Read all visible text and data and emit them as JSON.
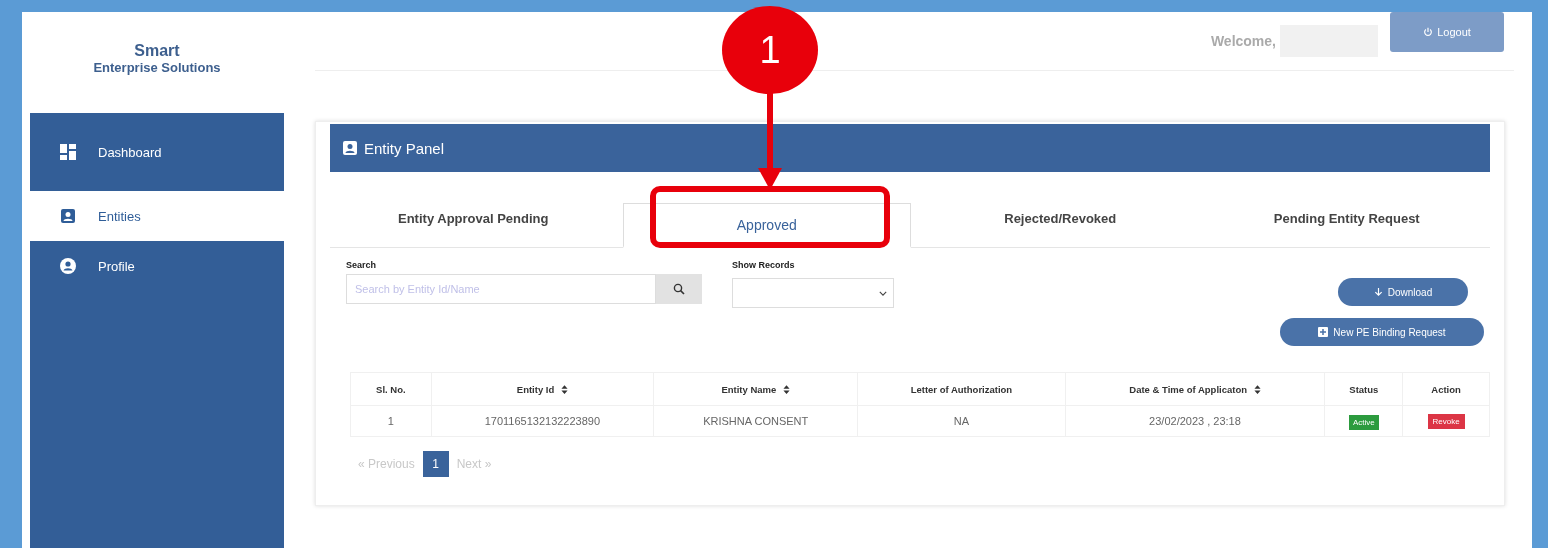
{
  "brand": {
    "title": "Smart",
    "subtitle": "Enterprise Solutions"
  },
  "sidebar": {
    "items": [
      {
        "label": "Dashboard",
        "kind": "dashboard",
        "selected": false
      },
      {
        "label": "Entities",
        "kind": "entity",
        "selected": true
      },
      {
        "label": "Profile",
        "kind": "profile",
        "selected": false
      }
    ]
  },
  "header": {
    "welcome": "Welcome,",
    "logout": "Logout"
  },
  "panel": {
    "title": "Entity Panel"
  },
  "tabs": [
    {
      "label": "Entity Approval Pending",
      "selected": false
    },
    {
      "label": "Approved",
      "selected": true
    },
    {
      "label": "Rejected/Revoked",
      "selected": false
    },
    {
      "label": "Pending Entity Request",
      "selected": false
    }
  ],
  "search": {
    "label": "Search",
    "placeholder": "Search by Entity Id/Name"
  },
  "show_records": {
    "label": "Show Records"
  },
  "buttons": {
    "download": "Download",
    "new_request": "New PE Binding Request"
  },
  "table": {
    "columns": [
      {
        "label": "Sl. No.",
        "sortable": false
      },
      {
        "label": "Entity Id",
        "sortable": true
      },
      {
        "label": "Entity Name",
        "sortable": true
      },
      {
        "label": "Letter of Authorization",
        "sortable": false
      },
      {
        "label": "Date & Time of Applicaton",
        "sortable": true
      },
      {
        "label": "Status",
        "sortable": false
      },
      {
        "label": "Action",
        "sortable": false
      }
    ],
    "rows": [
      {
        "sl": "1",
        "entity_id": "1701165132132223890",
        "entity_name": "KRISHNA CONSENT",
        "letter": "NA",
        "date_time": "23/02/2023 , 23:18",
        "status": "Active",
        "action": "Revoke"
      }
    ]
  },
  "pagination": {
    "previous": "« Previous",
    "pages": [
      {
        "label": "1",
        "selected": true
      }
    ],
    "next": "Next »"
  },
  "callout": {
    "number": "1"
  }
}
